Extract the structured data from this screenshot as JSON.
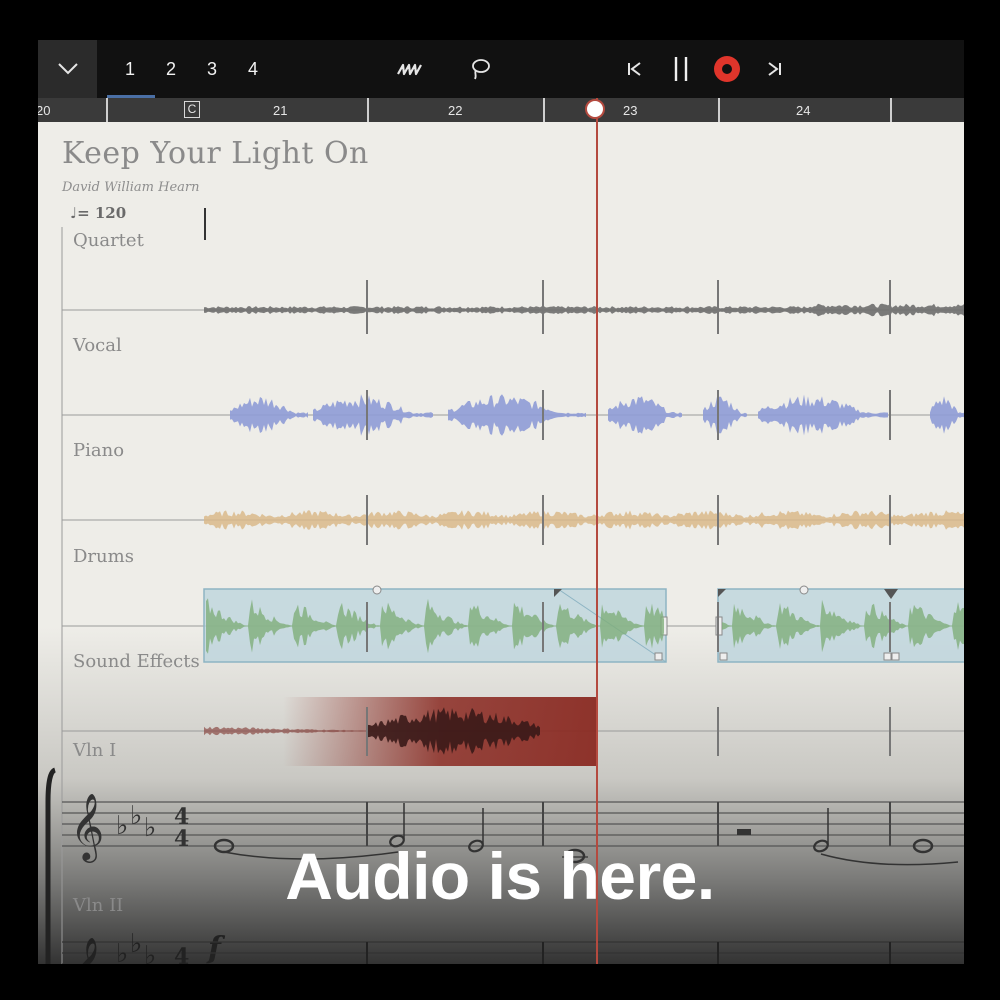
{
  "toolbar": {
    "pages": [
      "1",
      "2",
      "3",
      "4"
    ],
    "active_page": "1",
    "icons": [
      "chevron-down-icon",
      "scribble-pen-icon",
      "lasso-icon",
      "skip-back-icon",
      "pause-icon",
      "record-icon",
      "skip-forward-icon"
    ],
    "record_color": "#e0352b"
  },
  "ruler": {
    "bars": [
      "20",
      "21",
      "22",
      "23",
      "24"
    ],
    "marker": "C"
  },
  "score": {
    "title": "Keep Your Light On",
    "composer": "David William Hearn",
    "tempo": "= 120",
    "tracks": [
      "Quartet",
      "Vocal",
      "Piano",
      "Drums",
      "Sound Effects",
      "Vln I",
      "Vln II"
    ],
    "dynamic": "f",
    "time_signature": [
      "4",
      "4"
    ]
  },
  "colors": {
    "vocal_wave": "#8e9bd6",
    "piano_wave": "#d9b98a",
    "drums_wave": "#7fae7a",
    "drums_region": "#b9d3dc",
    "sfx_region": "#8a2a22",
    "playhead": "#b44a3f"
  },
  "caption": "Audio is here."
}
